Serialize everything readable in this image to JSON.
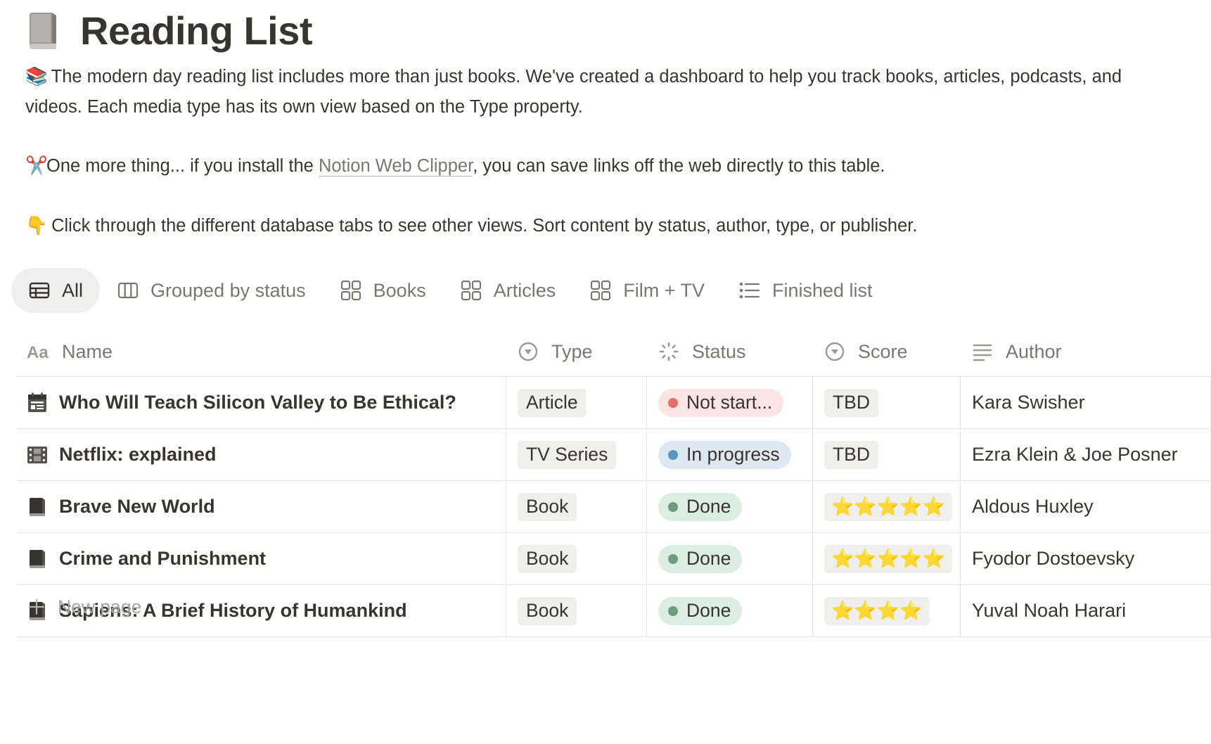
{
  "page": {
    "title": "Reading List",
    "icon": "book-icon"
  },
  "description": {
    "line1_emoji": "📚",
    "line1_text": "The modern day reading list includes more than just books. We've created a dashboard to help you track books, articles, podcasts, and videos. Each media type has its own view based on the Type property.",
    "line2_emoji": "✂️",
    "line2_before": "One more thing... if you install the ",
    "line2_link": "Notion Web Clipper",
    "line2_after": ", you can save links off the web directly to this table.",
    "line3_emoji": "👇",
    "line3_text": "Click through the different database tabs to see other views. Sort content by status, author, type, or publisher."
  },
  "tabs": [
    {
      "label": "All",
      "icon": "table-icon",
      "active": true
    },
    {
      "label": "Grouped by status",
      "icon": "board-icon",
      "active": false
    },
    {
      "label": "Books",
      "icon": "gallery-icon",
      "active": false
    },
    {
      "label": "Articles",
      "icon": "gallery-icon",
      "active": false
    },
    {
      "label": "Film + TV",
      "icon": "gallery-icon",
      "active": false
    },
    {
      "label": "Finished list",
      "icon": "list-icon",
      "active": false
    }
  ],
  "table": {
    "columns": [
      {
        "label": "Name",
        "icon": "text-property-icon"
      },
      {
        "label": "Type",
        "icon": "select-property-icon"
      },
      {
        "label": "Status",
        "icon": "status-property-icon"
      },
      {
        "label": "Score",
        "icon": "select-property-icon"
      },
      {
        "label": "Author",
        "icon": "text-lines-icon"
      }
    ],
    "rows": [
      {
        "name": "Who Will Teach Silicon Valley to Be Ethical?",
        "row_icon": "article-icon",
        "type": "Article",
        "status": "Not start...",
        "status_kind": "not-started",
        "score": "TBD",
        "author": "Kara Swisher"
      },
      {
        "name": "Netflix: explained",
        "row_icon": "film-icon",
        "type": "TV Series",
        "status": "In progress",
        "status_kind": "in-progress",
        "score": "TBD",
        "author": "Ezra Klein & Joe Posner"
      },
      {
        "name": "Brave New World",
        "row_icon": "book-icon",
        "type": "Book",
        "status": "Done",
        "status_kind": "done",
        "score": "⭐⭐⭐⭐⭐",
        "author": "Aldous Huxley"
      },
      {
        "name": "Crime and Punishment",
        "row_icon": "book-icon",
        "type": "Book",
        "status": "Done",
        "status_kind": "done",
        "score": "⭐⭐⭐⭐⭐",
        "author": "Fyodor Dostoevsky"
      },
      {
        "name": "Sapiens: A Brief History of Humankind",
        "row_icon": "book-icon",
        "type": "Book",
        "status": "Done",
        "status_kind": "done",
        "score": "⭐⭐⭐⭐",
        "author": "Yuval Noah Harari"
      }
    ],
    "new_page_label": "New page"
  },
  "colors": {
    "text": "#37352f",
    "muted": "#787774",
    "not_started_bg": "#fbe4e4",
    "not_started_dot": "#e16f64",
    "in_progress_bg": "#dde8f2",
    "in_progress_dot": "#5b97bd",
    "done_bg": "#dcede1",
    "done_dot": "#6c9b7d",
    "tag_bg": "#efefed",
    "star": "#f2c12e"
  }
}
